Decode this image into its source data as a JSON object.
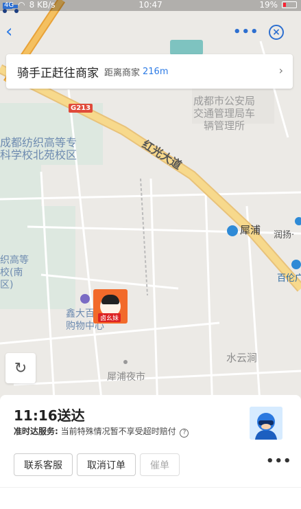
{
  "status_bar": {
    "signal": "4G",
    "speed": "8 KB/s",
    "time": "10:47",
    "battery": "19%"
  },
  "header": {
    "back_icon": "chevron-left-icon",
    "more_icon": "more-dots-icon",
    "close_icon": "close-circle-icon"
  },
  "rider_card": {
    "title": "骑手正赶往商家",
    "distance_label": "距离商家",
    "distance_value": "216m"
  },
  "map": {
    "labels": {
      "police": "成都市公安局\n交通管理局车\n辆管理所",
      "school": "成都纺织高等专\n科学校北苑校区",
      "road_hongguang": "红光大道",
      "road_g213": "G213",
      "xipu": "犀浦",
      "runyang": "润扬·",
      "school_left": "织高等\n校(南\n区)",
      "mall": "鑫大百\n购物中心",
      "shuiyun": "水云涧",
      "night_market": "犀浦夜市",
      "baiwei": "百伦广",
      "shop_tag": "卤幺妹"
    }
  },
  "delivery": {
    "eta": "11:16送达",
    "ontime_label": "准时达服务:",
    "ontime_text": "当前特殊情况暂不享受超时赔付",
    "help_icon": "?",
    "buttons": {
      "contact": "联系客服",
      "cancel": "取消订单",
      "urge": "催单"
    },
    "more": "•••"
  },
  "colors": {
    "accent": "#2d7be5",
    "shop": "#f26a2a",
    "road_major": "#f3c460"
  }
}
